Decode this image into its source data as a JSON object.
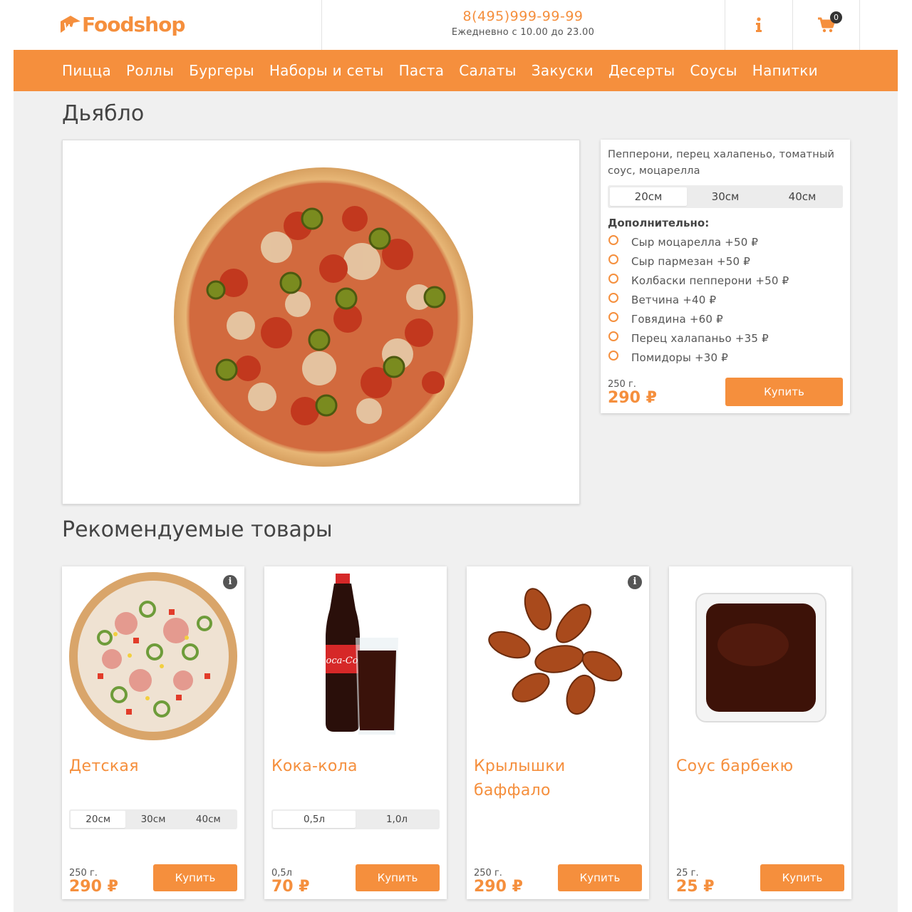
{
  "header": {
    "brand": "Foodshop",
    "phone": "8(495)999-99-99",
    "hours": "Ежедневно с 10.00 до 23.00",
    "cart_count": "0",
    "info_icon": "info-icon",
    "cart_icon": "cart-icon"
  },
  "nav": {
    "items": [
      "Пицца",
      "Роллы",
      "Бургеры",
      "Наборы и сеты",
      "Паста",
      "Салаты",
      "Закуски",
      "Десерты",
      "Соусы",
      "Напитки"
    ]
  },
  "product": {
    "title": "Дьябло",
    "description": "Пепперони, перец халапеньо, томатный соус, моцарелла",
    "sizes": [
      "20см",
      "30см",
      "40см"
    ],
    "selected_size": "20см",
    "extras_title": "Дополнительно:",
    "extras": [
      "Сыр моцарелла +50 ₽",
      "Сыр пармезан +50 ₽",
      "Колбаски пепперони +50 ₽",
      "Ветчина +40 ₽",
      "Говядина +60 ₽",
      "Перец халапаньо +35 ₽",
      "Помидоры +30 ₽"
    ],
    "weight": "250 г.",
    "price": "290 ₽",
    "buy_label": "Купить"
  },
  "recommended": {
    "title": "Рекомендуемые товары",
    "cards": [
      {
        "name": "Детская",
        "options": [
          "20см",
          "30см",
          "40см"
        ],
        "selected": "20см",
        "weight": "250 г.",
        "price": "290 ₽",
        "buy_label": "Купить",
        "has_info": true
      },
      {
        "name": "Кока-кола",
        "options": [
          "0,5л",
          "1,0л"
        ],
        "selected": "0,5л",
        "weight": "0,5л",
        "price": "70 ₽",
        "buy_label": "Купить",
        "has_info": false
      },
      {
        "name": "Крылышки баффало",
        "options": [],
        "selected": "",
        "weight": "250 г.",
        "price": "290 ₽",
        "buy_label": "Купить",
        "has_info": true
      },
      {
        "name": "Соус барбекю",
        "options": [],
        "selected": "",
        "weight": "25 г.",
        "price": "25 ₽",
        "buy_label": "Купить",
        "has_info": false
      }
    ]
  },
  "colors": {
    "accent": "#f58f3d",
    "background": "#f0f0f0"
  }
}
